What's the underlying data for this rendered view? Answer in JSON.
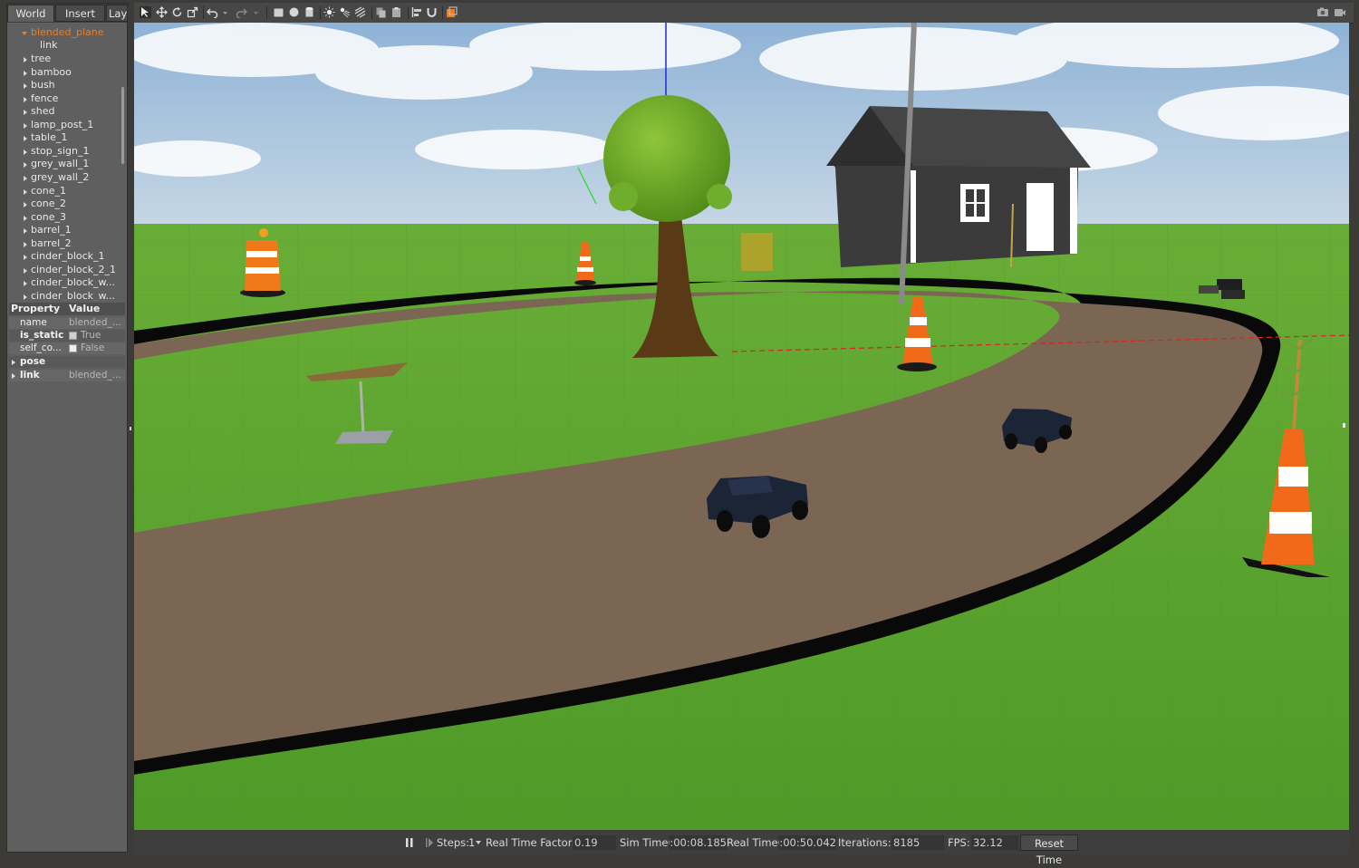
{
  "left_panel": {
    "tabs": [
      "World",
      "Insert",
      "Layers"
    ],
    "tree": {
      "root": "blended_plane",
      "root_child": "link",
      "models": [
        "tree",
        "bamboo",
        "bush",
        "fence",
        "shed",
        "lamp_post_1",
        "table_1",
        "stop_sign_1",
        "grey_wall_1",
        "grey_wall_2",
        "cone_1",
        "cone_2",
        "cone_3",
        "barrel_1",
        "barrel_2",
        "cinder_block_1",
        "cinder_block_2_1",
        "cinder_block_w...",
        "cinder_block_w..."
      ]
    },
    "properties": {
      "header_property": "Property",
      "header_value": "Value",
      "rows": [
        {
          "key": "name",
          "value": "blended_..."
        },
        {
          "key": "is_static",
          "value": "True",
          "checked": true
        },
        {
          "key": "self_co...",
          "value": "False",
          "checked": false
        },
        {
          "key": "pose",
          "value": ""
        },
        {
          "key": "link",
          "value": "blended_..."
        }
      ]
    }
  },
  "toolbar": {
    "icons": [
      "select-icon",
      "translate-icon",
      "rotate-icon",
      "scale-icon",
      "undo-icon",
      "undo-dropdown-icon",
      "redo-icon",
      "redo-dropdown-icon",
      "box-icon",
      "sphere-icon",
      "cylinder-icon",
      "point-light-icon",
      "spot-light-icon",
      "directional-light-icon",
      "copy-icon",
      "paste-icon",
      "align-icon",
      "snap-icon",
      "change-view-icon",
      "screenshot-icon",
      "record-icon"
    ]
  },
  "bottom_bar": {
    "steps_label": "Steps:",
    "steps_value": "1",
    "rtf_label": "Real Time Factor:",
    "rtf_value": "0.19",
    "sim_time_label": "Sim Time:",
    "sim_time_value": "00:00:08.185",
    "real_time_label": "Real Time:",
    "real_time_value": "00:00:50.042",
    "iterations_label": "Iterations:",
    "iterations_value": "8185",
    "fps_label": "FPS:",
    "fps_value": "32.12",
    "reset_label": "Reset Time"
  },
  "colors": {
    "accent": "#f07c1b",
    "panel_bg": "#5f5f5f",
    "sky": "#a6c2dd",
    "grass": "#5aa32e",
    "track": "#7a6652"
  }
}
